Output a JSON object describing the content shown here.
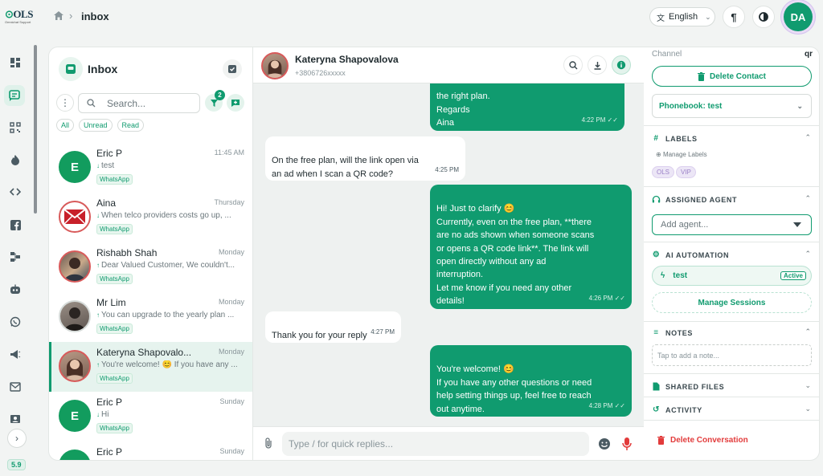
{
  "app": {
    "logo_text": "OLS",
    "logo_sub": "Omnichat Support",
    "version": "5.9"
  },
  "breadcrumb": {
    "current": "inbox"
  },
  "topbar": {
    "language": "English",
    "user_initials": "DA"
  },
  "inbox": {
    "title": "Inbox",
    "search_placeholder": "Search...",
    "filter_count": "2",
    "filters": [
      "All",
      "Unread",
      "Read"
    ],
    "conversations": [
      {
        "name": "Eric P",
        "time": "11:45 AM",
        "preview": "test",
        "direction": "in",
        "channel": "WhatsApp",
        "avatar": "E"
      },
      {
        "name": "Aina",
        "time": "Thursday",
        "preview": "When telco providers costs go up, ...",
        "direction": "in",
        "channel": "WhatsApp",
        "avatar": ""
      },
      {
        "name": "Rishabh Shah",
        "time": "Monday",
        "preview": "Dear Valued Customer, We couldn't...",
        "direction": "out",
        "channel": "WhatsApp",
        "avatar": ""
      },
      {
        "name": "Mr Lim",
        "time": "Monday",
        "preview": "You can upgrade to the yearly plan ...",
        "direction": "out",
        "channel": "WhatsApp",
        "avatar": ""
      },
      {
        "name": "Kateryna Shapovalo...",
        "time": "Monday",
        "preview": "You're welcome! 😊 If you have any ...",
        "direction": "out",
        "channel": "WhatsApp",
        "avatar": ""
      },
      {
        "name": "Eric P",
        "time": "Sunday",
        "preview": "Hi",
        "direction": "in",
        "channel": "WhatsApp",
        "avatar": "E"
      },
      {
        "name": "Eric P",
        "time": "Sunday",
        "preview": "",
        "direction": "in",
        "channel": "WhatsApp",
        "avatar": "E"
      }
    ]
  },
  "chat": {
    "contact_name": "Kateryna Shapovalova",
    "contact_phone": "+3806726xxxxx",
    "input_placeholder": "Type / for quick replies...",
    "messages": [
      {
        "dir": "out",
        "text": "the right plan.\nRegards\nAina",
        "time": "4:22 PM"
      },
      {
        "dir": "in",
        "text": "On the free plan, will the link open via\nan ad when I scan a QR code?",
        "time": "4:25 PM"
      },
      {
        "dir": "out",
        "text": "Hi! Just to clarify 😊\nCurrently, even on the free plan, **there\nare no ads shown when someone scans\nor opens a QR code link**. The link will\nopen directly without any ad\ninterruption.\nLet me know if you need any other\ndetails!",
        "time": "4:26 PM"
      },
      {
        "dir": "in",
        "text": "Thank you for your reply",
        "time": "4:27 PM"
      },
      {
        "dir": "out",
        "text": "You're welcome! 😊\nIf you have any other questions or need\nhelp setting things up, feel free to reach\nout anytime.",
        "time": "4:28 PM"
      }
    ]
  },
  "panel": {
    "channel_label": "Channel",
    "channel_value": "qr",
    "delete_contact": "Delete Contact",
    "phonebook": "Phonebook: test",
    "labels_title": "LABELS",
    "manage_labels": "Manage Labels",
    "labels": [
      "OLS",
      "VIP"
    ],
    "agent_title": "ASSIGNED AGENT",
    "agent_placeholder": "Add agent...",
    "automation_title": "AI AUTOMATION",
    "automation_name": "test",
    "automation_status": "Active",
    "manage_sessions": "Manage Sessions",
    "notes_title": "NOTES",
    "notes_placeholder": "Tap to add a note...",
    "files_title": "SHARED FILES",
    "activity_title": "ACTIVITY",
    "delete_conversation": "Delete Conversation"
  },
  "colors": {
    "accent": "#109b6f",
    "danger": "#e23b3b",
    "label_chip": "#ece6f6"
  }
}
